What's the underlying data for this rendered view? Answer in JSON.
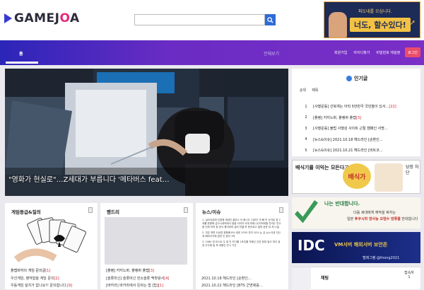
{
  "header": {
    "logo_text_a": "GAMEJ",
    "logo_text_o": "O",
    "logo_text_b": "A",
    "search_placeholder": "",
    "banner_sub": "파도네를 오십니다.",
    "banner_main": "너도, 할수있다!"
  },
  "nav": {
    "home": "홈",
    "all": "전체보기",
    "links": [
      "회원가입",
      "아이디찾기",
      "비밀번호 재설정"
    ],
    "login": "로그인"
  },
  "hero": {
    "caption": "\"영화가 현실로\"…Z세대가 부릅니다 '메타버스 feat…"
  },
  "popular": {
    "title": "인기글",
    "head_rank": "순위",
    "head_title": "제목",
    "items": [
      {
        "rank": "1",
        "title": "[사행운동] 선복게는 아직 5만만극 국민들이 있서…",
        "count": "[22]"
      },
      {
        "rank": "2",
        "title": "[플랭] 카지노바, 플랭바 플랩",
        "count": "[3]"
      },
      {
        "rank": "3",
        "title": "[사행운동] 불법 사행성 사이트 근절 캠페인 서명…",
        "count": ""
      },
      {
        "rank": "4",
        "title": "[뉴스&이슈] 2021.10.18 헤드라인 [순환인…",
        "count": ""
      },
      {
        "rank": "5",
        "title": "[뉴스&이슈] 2021.10.21 헤드라인 [비트코…",
        "count": ""
      }
    ]
  },
  "ads": {
    "ad1_left": "배식기를 이익는 모든다고",
    "ad1_mid": "배식가",
    "ad1_right": "당장 차단",
    "ad2_head": "나는 반대합니다.",
    "ad2_l1": "다음 세대에게 재작을 꿔지는",
    "ad2_l2_pre": "일본 ",
    "ad2_l2_bold": "후쿠시마 방사능 오염수 방류를",
    "ad2_l2_post": " 반대합니다",
    "ad3_idc": "IDC",
    "ad3_vm": "VM서버  해외서버  보안존",
    "ad3_tg": "텔레그램 @thong2021"
  },
  "chat": {
    "title": "채팅",
    "count_label": "접속자",
    "count": "1"
  },
  "cards": {
    "grade": {
      "title": "게임등급&질의",
      "caption": "플랩바하의 게임 문의글",
      "caption_count": "[1]",
      "items": [
        {
          "text": "우선게임, 병약합을 게임 문의",
          "count": "[2]"
        },
        {
          "text": "우동게임 설치가 없나요?! 문의합니다.",
          "count": "[9]"
        }
      ]
    },
    "gallery": {
      "title": "핸드리",
      "caption": "[플랭] 카지노바, 플랭바 플랩",
      "caption_count": "[3]",
      "items": [
        {
          "text": "[슬롯머신] 슬롯머신 한소슬롯 맥핫왕서",
          "count": "[4]"
        },
        {
          "text": "[바카라] 바카라에서 돈따는 법 [팁]",
          "count": "[1]"
        }
      ]
    },
    "news": {
      "title": "뉴스/이슈",
      "paras": [
        "1. 실리국금에 인경에 세대인 꿀쥐스 더 빠 [국 그]보이 여 빠 보 순이된 경 2 개를 한형화 금고시대어때서 점음 서저자 낙세 마례 (3)지하세월 잔아는 연고중 인체 의약 등 방식 용어대의 설의 잔을 하 문어요고 잘한 공문 네 게 나설",
        "2. 각은 최면 사상업 현형배 8% 세운 2030 관리 10% 뉴 금 뉴노석센 지산세 해외국가에 경권 인 장터 1억",
        "3. 1980 넷 리스트 두 정 인 보그를 1조주를 차용신 간은 현대 일으 미디 등 영 주주에 일 보 개원인 간시 기간"
      ],
      "items": [
        {
          "text": "2021.10.18 헤드라인 [순환인…",
          "count": ""
        },
        {
          "text": "2021.10.22 헤드라인 [BTS 군면제를…",
          "count": ""
        }
      ]
    }
  }
}
